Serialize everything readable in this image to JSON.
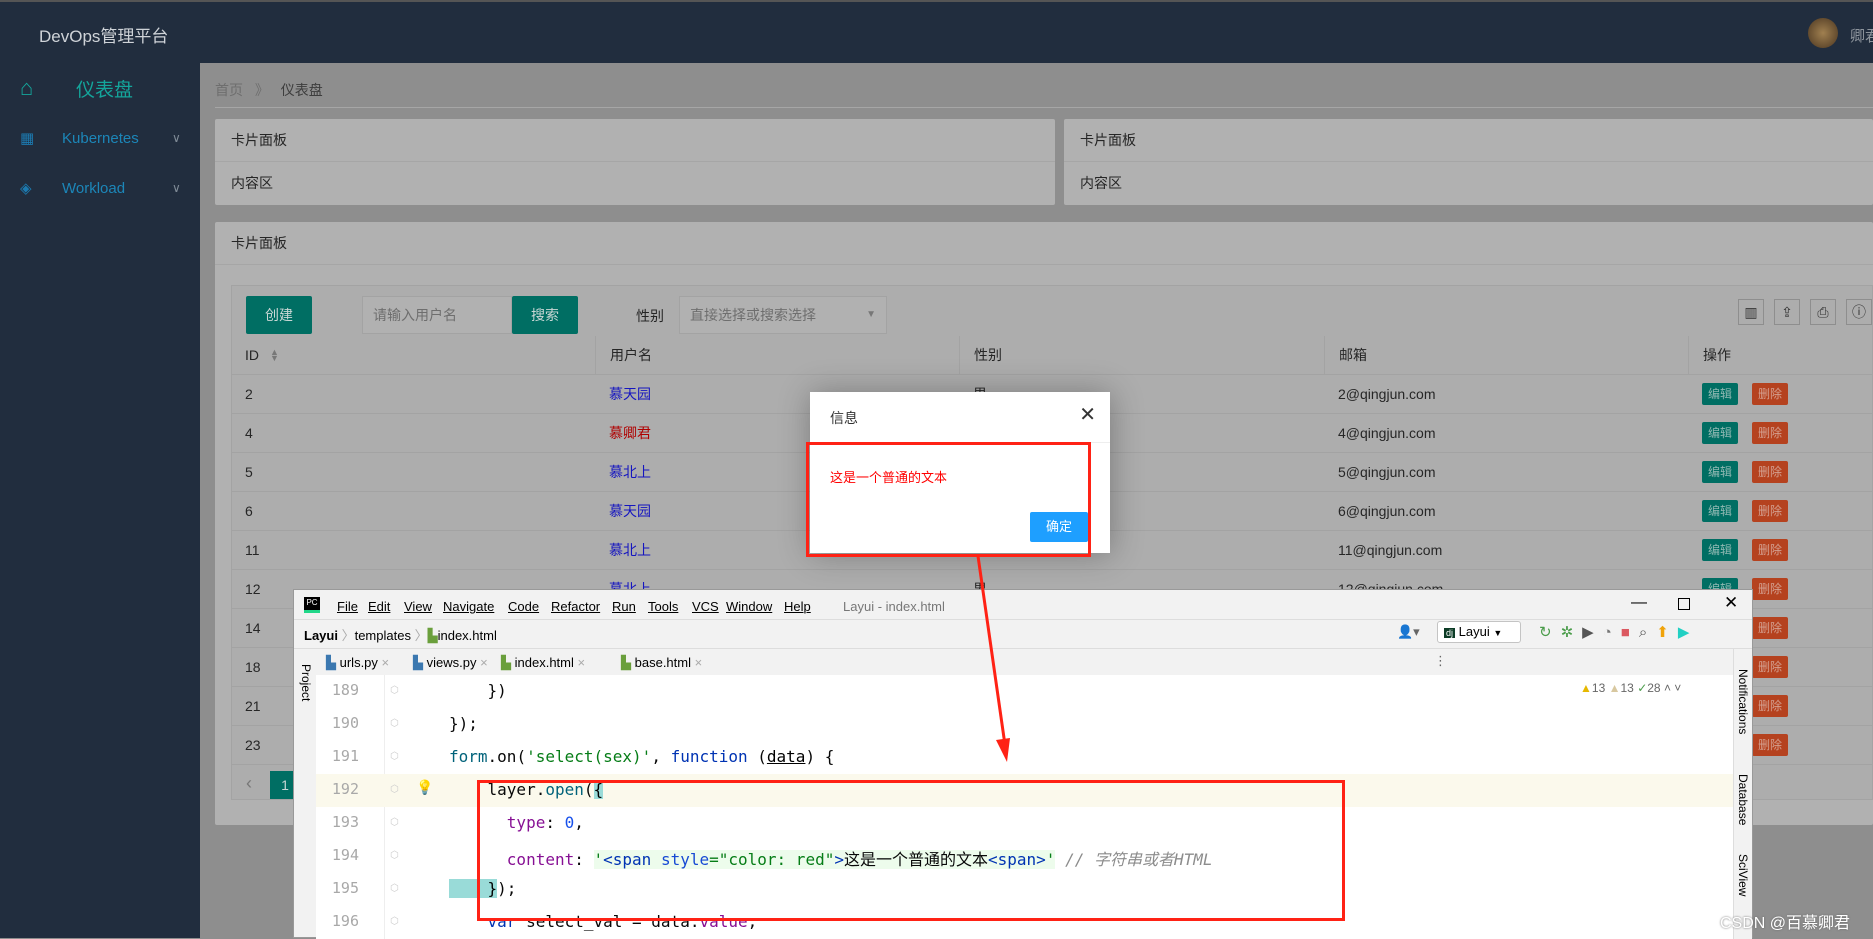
{
  "header": {
    "brand": "DevOps管理平台",
    "user": "卿君"
  },
  "sidebar": {
    "items": [
      {
        "label": "仪表盘",
        "icon": "home-icon"
      },
      {
        "label": "Kubernetes",
        "icon": "grid-icon"
      },
      {
        "label": "Workload",
        "icon": "layers-icon"
      }
    ]
  },
  "breadcrumb": {
    "home": "首页",
    "sep": "》",
    "current": "仪表盘"
  },
  "cards": [
    {
      "title": "卡片面板",
      "body": "内容区"
    },
    {
      "title": "卡片面板",
      "body": "内容区"
    },
    {
      "title": "卡片面板"
    }
  ],
  "toolbar": {
    "create": "创建",
    "search_placeholder": "请输入用户名",
    "search": "搜索",
    "gender_label": "性别",
    "gender_placeholder": "直接选择或搜索选择"
  },
  "table": {
    "columns": [
      "ID",
      "用户名",
      "性别",
      "邮箱",
      "操作"
    ],
    "edit_label": "编辑",
    "delete_label": "删除",
    "rows": [
      {
        "id": "2",
        "name": "慕天园",
        "gender": "男",
        "email": "2@qingjun.com"
      },
      {
        "id": "4",
        "name": "慕卿君",
        "gender": "",
        "email": "4@qingjun.com",
        "highlight": true
      },
      {
        "id": "5",
        "name": "慕北上",
        "gender": "",
        "email": "5@qingjun.com"
      },
      {
        "id": "6",
        "name": "慕天园",
        "gender": "",
        "email": "6@qingjun.com"
      },
      {
        "id": "11",
        "name": "慕北上",
        "gender": "",
        "email": "11@qingjun.com"
      },
      {
        "id": "12",
        "name": "慕北上",
        "gender": "男",
        "email": "12@qingjun.com"
      },
      {
        "id": "14",
        "name": "",
        "gender": "",
        "email": ""
      },
      {
        "id": "18",
        "name": "",
        "gender": "",
        "email": ""
      },
      {
        "id": "21",
        "name": "",
        "gender": "",
        "email": ""
      },
      {
        "id": "23",
        "name": "",
        "gender": "",
        "email": ""
      }
    ],
    "page": "1"
  },
  "dialog": {
    "title": "信息",
    "content": "这是一个普通的文本",
    "ok": "确定",
    "content_color": "#ff0000"
  },
  "ide": {
    "menu": [
      "File",
      "Edit",
      "View",
      "Navigate",
      "Code",
      "Refactor",
      "Run",
      "Tools",
      "VCS",
      "Window",
      "Help"
    ],
    "title": "Layui - index.html",
    "breadcrumb": [
      "Layui",
      "templates",
      "index.html"
    ],
    "run_config": "Layui",
    "tabs": [
      {
        "label": "urls.py"
      },
      {
        "label": "views.py"
      },
      {
        "label": "index.html",
        "active": true
      },
      {
        "label": "base.html"
      }
    ],
    "inspections": {
      "warnings": "13",
      "weak_warnings": "13",
      "typos": "28"
    },
    "side_tools": [
      "Project",
      "Notifications",
      "Database",
      "SciView"
    ],
    "lines": [
      {
        "num": "189",
        "tokens": [
          [
            "k-def",
            "    })"
          ]
        ]
      },
      {
        "num": "190",
        "tokens": [
          [
            "k-def",
            "});"
          ]
        ]
      },
      {
        "num": "191",
        "tokens": [
          [
            "k-fn",
            "form"
          ],
          [
            "k-def",
            "."
          ],
          [
            "k-def",
            "on("
          ],
          [
            "k-str",
            "'select(sex)'"
          ],
          [
            "k-def",
            ", "
          ],
          [
            "k-kw",
            "function"
          ],
          [
            "k-def",
            " ("
          ],
          [
            "k-ul",
            "data"
          ],
          [
            "k-def",
            ") {"
          ]
        ]
      },
      {
        "num": "192",
        "tokens": [
          [
            "k-def",
            "    layer."
          ],
          [
            "k-fn",
            "open"
          ],
          [
            "k-def",
            "("
          ],
          [
            "k-brace",
            "{"
          ]
        ],
        "current": true
      },
      {
        "num": "193",
        "tokens": [
          [
            "k-prop",
            "      type"
          ],
          [
            "k-def",
            ": "
          ],
          [
            "k-num",
            "0"
          ],
          [
            "k-def",
            ","
          ]
        ]
      },
      {
        "num": "194",
        "tokens": [
          [
            "k-prop",
            "      content"
          ],
          [
            "k-def",
            ": "
          ],
          [
            "k-str",
            "'"
          ],
          [
            "k-tag",
            "<span "
          ],
          [
            "k-attr",
            "style"
          ],
          [
            "k-str",
            "=\"color: red\""
          ],
          [
            "k-tag",
            ">"
          ],
          [
            "k-def",
            "这是一个普通的文本"
          ],
          [
            "k-tag",
            "<span>"
          ],
          [
            "k-str",
            "'"
          ],
          [
            "k-cmt",
            " // 字符串或者HTML"
          ]
        ]
      },
      {
        "num": "195",
        "tokens": [
          [
            "k-brace",
            "    }"
          ],
          [
            "k-def",
            ");"
          ]
        ]
      },
      {
        "num": "196",
        "tokens": [
          [
            "k-kw",
            "    var "
          ],
          [
            "k-def",
            "select_val = data."
          ],
          [
            "k-prop",
            "value"
          ],
          [
            "k-def",
            ";"
          ]
        ]
      }
    ]
  },
  "watermark": "CSDN @百慕卿君"
}
